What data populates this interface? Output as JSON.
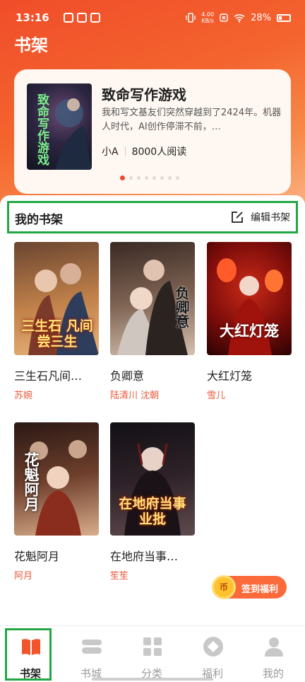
{
  "status_bar": {
    "time": "13:16",
    "net_speed_value": "4.00",
    "net_speed_unit": "KB/s",
    "battery": "28%",
    "icons": [
      "vibrate-icon",
      "network-speed-icon",
      "close-box-icon",
      "wifi-icon",
      "battery-icon"
    ]
  },
  "header": {
    "title": "书架"
  },
  "featured": {
    "cover_text": "致命写作游戏",
    "title": "致命写作游戏",
    "description": "我和写文基友们突然穿越到了2424年。机器人时代，AI创作停滞不前，…",
    "author": "小A",
    "readers": "8000人阅读",
    "carousel_dot_count": 8,
    "carousel_active_index": 0
  },
  "shelf": {
    "title": "我的书架",
    "edit_label": "编辑书架",
    "books": [
      {
        "cover_text": "三生石 凡间尝三生",
        "title": "三生石凡间…",
        "author": "苏婉",
        "cover_colors": [
          "#5a3a28",
          "#c77a3b",
          "#e7b97a"
        ]
      },
      {
        "cover_text": "负卿意",
        "title": "负卿意",
        "author": "陆清川 沈朝",
        "cover_colors": [
          "#3b2a24",
          "#8a6a5a",
          "#d8c2b0"
        ]
      },
      {
        "cover_text": "大红灯笼",
        "title": "大红灯笼",
        "author": "雪儿",
        "cover_colors": [
          "#3a0707",
          "#a5170f",
          "#ff6b3a"
        ]
      },
      {
        "cover_text": "花魁阿月",
        "title": "花魁阿月",
        "author": "阿月",
        "cover_colors": [
          "#2a1814",
          "#7a4a35",
          "#e0b596"
        ]
      },
      {
        "cover_text": "在地府当事业批",
        "title": "在地府当事…",
        "author": "笙笙",
        "cover_colors": [
          "#121015",
          "#3a2b33",
          "#b59b9b"
        ]
      }
    ]
  },
  "checkin": {
    "coin_label": "币",
    "label": "签到福利"
  },
  "bottom_nav": {
    "items": [
      {
        "label": "书架",
        "icon": "book-open-icon",
        "active": true
      },
      {
        "label": "书城",
        "icon": "bookstore-icon",
        "active": false
      },
      {
        "label": "分类",
        "icon": "grid-icon",
        "active": false
      },
      {
        "label": "福利",
        "icon": "gift-diamond-icon",
        "active": false
      },
      {
        "label": "我的",
        "icon": "user-icon",
        "active": false
      }
    ]
  },
  "colors": {
    "accent": "#ee4a2c",
    "author_red": "#e8593a",
    "highlight_green": "#22a744",
    "active_nav_orange": "#f2552c"
  }
}
